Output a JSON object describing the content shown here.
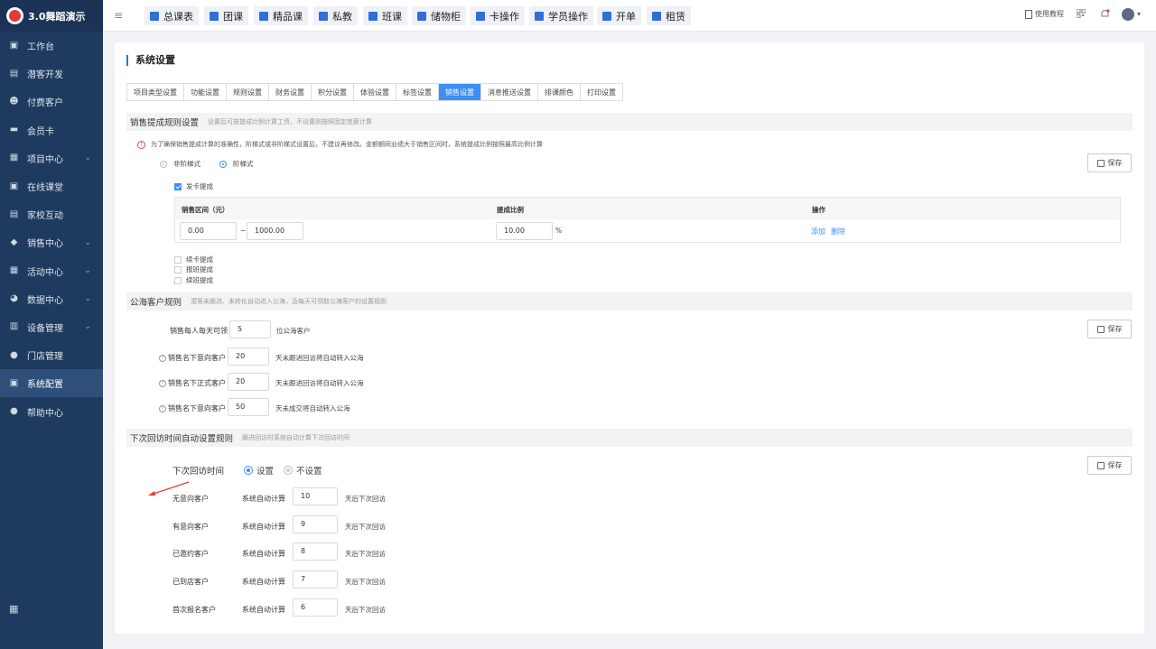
{
  "brand": {
    "name": "3.0舞蹈演示"
  },
  "sidebar": {
    "items": [
      {
        "label": "工作台",
        "icon": "monitor-icon",
        "glyph": "▣"
      },
      {
        "label": "潜客开发",
        "icon": "prospect-icon",
        "glyph": "▤"
      },
      {
        "label": "付费客户",
        "icon": "customer-icon",
        "glyph": "☻"
      },
      {
        "label": "会员卡",
        "icon": "card-icon",
        "glyph": "▬"
      },
      {
        "label": "项目中心",
        "icon": "project-icon",
        "glyph": "▦",
        "chevron": "⌄"
      },
      {
        "label": "在线课堂",
        "icon": "classroom-icon",
        "glyph": "▣"
      },
      {
        "label": "家校互动",
        "icon": "interaction-icon",
        "glyph": "▤"
      },
      {
        "label": "销售中心",
        "icon": "sales-icon",
        "glyph": "◆",
        "chevron": "⌄"
      },
      {
        "label": "活动中心",
        "icon": "activity-icon",
        "glyph": "▦",
        "chevron": "⌄"
      },
      {
        "label": "数据中心",
        "icon": "data-icon",
        "glyph": "◕",
        "chevron": "⌄"
      },
      {
        "label": "设备管理",
        "icon": "device-icon",
        "glyph": "▥",
        "chevron": "⌄"
      },
      {
        "label": "门店管理",
        "icon": "store-icon",
        "glyph": "●"
      },
      {
        "label": "系统配置",
        "icon": "system-icon",
        "glyph": "▣",
        "active": true
      },
      {
        "label": "帮助中心",
        "icon": "help-icon",
        "glyph": "●"
      }
    ],
    "bottom_glyph": "▦"
  },
  "topbar": {
    "menu_glyph": "≡",
    "buttons": [
      "总课表",
      "团课",
      "精品课",
      "私教",
      "班课",
      "储物柜",
      "卡操作",
      "学员操作",
      "开单",
      "租赁"
    ],
    "tutorial": "使用教程",
    "avatar_chevron": "▾"
  },
  "page": {
    "title": "系统设置",
    "tabs": [
      "项目类型设置",
      "功能设置",
      "规则设置",
      "财务设置",
      "积分设置",
      "体验设置",
      "标签设置",
      "销售设置",
      "消息推送设置",
      "排课颜色",
      "打印设置"
    ],
    "active_tab": 7,
    "save_label": "保存"
  },
  "commission": {
    "title": "销售提成规则设置",
    "hint": "设置后可按提成比例计算工资，不设置则按照固定底薪计算",
    "warning": "为了确保销售提成计算的准确性，阶梯式或非阶梯式设置后，不建议再修改。金额额同业绩大于销售区间时，系统提成比例按照最高比例计算",
    "warning_glyph": "!",
    "mode_non_tiered": "非阶梯式",
    "mode_tiered": "阶梯式",
    "card_commission": "发卡提成",
    "table_headers": {
      "range": "销售区间（元）",
      "ratio": "提成比例",
      "action": "操作"
    },
    "row": {
      "from": "0.00",
      "tilde": "~",
      "to": "1000.00",
      "ratio": "10.00",
      "percent": "%",
      "add": "添加",
      "delete": "删除"
    },
    "renew_card": "续卡提成",
    "enroll_class": "报班提成",
    "renew_class": "续班提成"
  },
  "public_pool": {
    "title": "公海客户规则",
    "hint": "潜客未跟进、未转化自动进入公海，及每天可领取公海客户的设置规则",
    "q_glyph": "?",
    "rows": [
      {
        "label": "销售每人每天可领",
        "value": "5",
        "suffix": "位公海客户",
        "help": false
      },
      {
        "label": "销售名下意向客户",
        "value": "20",
        "suffix": "天未跟进回访将自动转入公海",
        "help": true
      },
      {
        "label": "销售名下正式客户",
        "value": "20",
        "suffix": "天未跟进回访将自动转入公海",
        "help": true
      },
      {
        "label": "销售名下意向客户",
        "value": "50",
        "suffix": "天未成交将自动转入公海",
        "help": true
      }
    ]
  },
  "next_visit": {
    "title": "下次回访时间自动设置规则",
    "hint": "跟进回访时系统自动计算下次回访时间",
    "label": "下次回访时间",
    "option_set": "设置",
    "option_unset": "不设置",
    "auto_calc": "系统自动计算",
    "suffix": "天后下次回访",
    "rows": [
      {
        "label": "无意向客户",
        "value": "10"
      },
      {
        "label": "有意向客户",
        "value": "9"
      },
      {
        "label": "已邀约客户",
        "value": "8"
      },
      {
        "label": "已到店客户",
        "value": "7"
      },
      {
        "label": "首次报名客户",
        "value": "6"
      }
    ]
  },
  "colors": {
    "accent": "#3d8ff5",
    "sidebar": "#1e3a5f",
    "warning": "#e04b4b",
    "annotation_arrow": "#e83a2f"
  }
}
